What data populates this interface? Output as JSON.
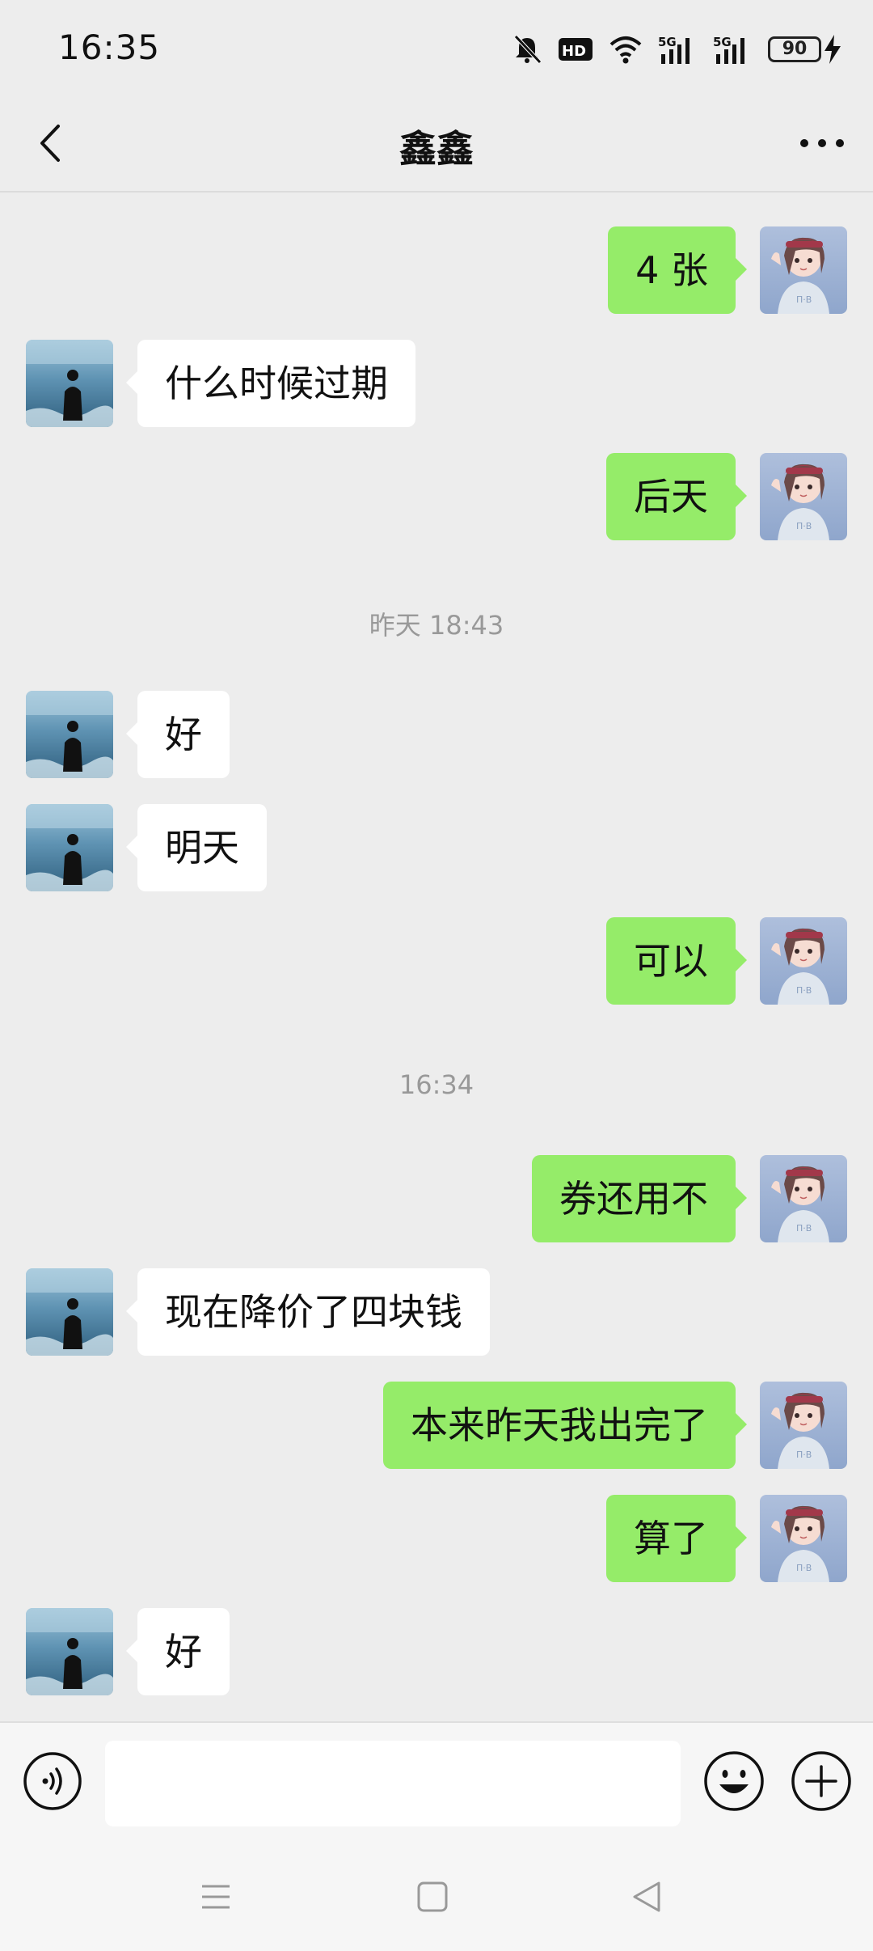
{
  "status_bar": {
    "time": "16:35",
    "hd_label": "HD",
    "signal_label_1": "5G",
    "signal_label_2": "5G",
    "battery": "90",
    "icons": [
      "mute-icon",
      "hd-icon",
      "wifi-icon",
      "signal-5g-icon",
      "signal-5g-icon",
      "battery-icon",
      "charging-icon"
    ]
  },
  "header": {
    "title": "鑫鑫",
    "back_icon": "chevron-left-icon",
    "more_icon": "more-icon"
  },
  "chat": {
    "messages": [
      {
        "side": "right",
        "text": "4 张"
      },
      {
        "side": "left",
        "text": "什么时候过期"
      },
      {
        "side": "right",
        "text": "后天"
      },
      {
        "side": "left",
        "text": "好"
      },
      {
        "side": "left",
        "text": "明天"
      },
      {
        "side": "right",
        "text": "可以"
      },
      {
        "side": "right",
        "text": "券还用不"
      },
      {
        "side": "left",
        "text": "现在降价了四块钱"
      },
      {
        "side": "right",
        "text": "本来昨天我出完了"
      },
      {
        "side": "right",
        "text": "算了"
      },
      {
        "side": "left",
        "text": "好"
      }
    ],
    "timestamps": [
      "昨天 18:43",
      "16:34"
    ]
  },
  "input_bar": {
    "value": "",
    "icons": [
      "voice-icon",
      "emoji-icon",
      "plus-icon"
    ]
  },
  "system_nav": {
    "icons": [
      "menu-icon",
      "home-icon",
      "back-icon"
    ]
  },
  "colors": {
    "background": "#ededed",
    "outgoing_bubble": "#95ec69",
    "incoming_bubble": "#ffffff",
    "timestamp_text": "#999999"
  }
}
